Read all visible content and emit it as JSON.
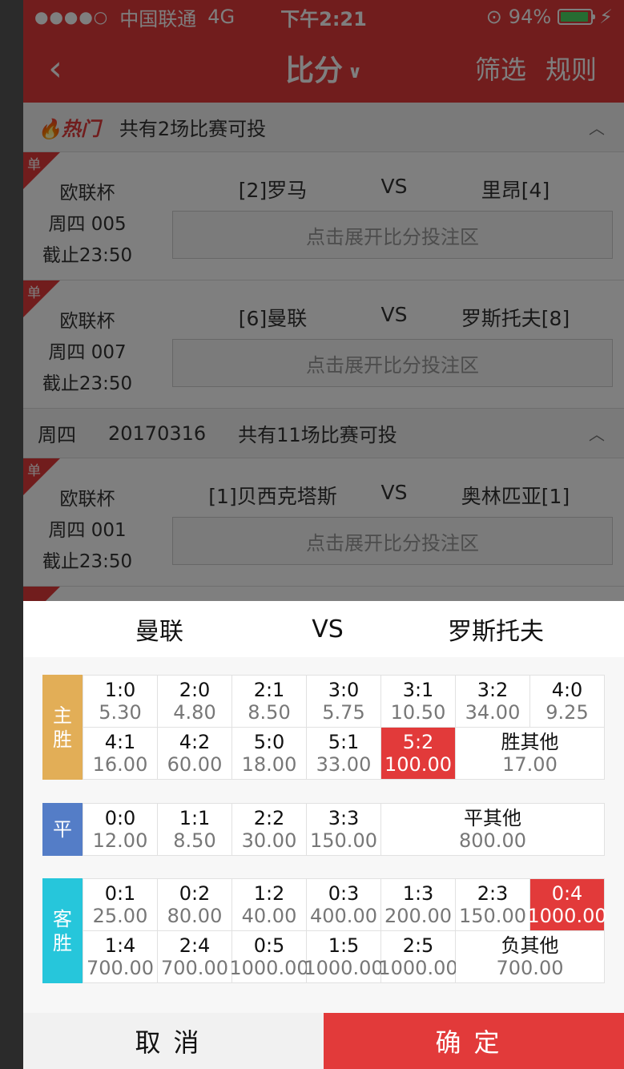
{
  "status_bar": {
    "carrier": "中国联通",
    "network": "4G",
    "time": "下午2:21",
    "battery": "94%",
    "battery_level": 0.94
  },
  "nav": {
    "title": "比分",
    "filter": "筛选",
    "rules": "规则"
  },
  "list": {
    "hot_section": {
      "label": "热门",
      "summary": "共有2场比赛可投"
    },
    "date_section": {
      "weekday": "周四",
      "date": "20170316",
      "summary": "共有11场比赛可投"
    },
    "badge": "单",
    "expand_hint": "点击展开比分投注区",
    "matches": [
      {
        "league": "欧联杯",
        "code": "周四 005",
        "deadline": "截止23:50",
        "home": "[2]罗马",
        "vs": "VS",
        "away": "里昂[4]"
      },
      {
        "league": "欧联杯",
        "code": "周四 007",
        "deadline": "截止23:50",
        "home": "[6]曼联",
        "vs": "VS",
        "away": "罗斯托夫[8]"
      },
      {
        "league": "欧联杯",
        "code": "周四 001",
        "deadline": "截止23:50",
        "home": "[1]贝西克塔斯",
        "vs": "VS",
        "away": "奥林匹亚[1]"
      }
    ]
  },
  "sheet": {
    "home": "曼联",
    "vs": "VS",
    "away": "罗斯托夫",
    "home_win": {
      "label": "主胜",
      "color": "#e2ae57",
      "cells": [
        {
          "score": "1:0",
          "odds": "5.30"
        },
        {
          "score": "2:0",
          "odds": "4.80"
        },
        {
          "score": "2:1",
          "odds": "8.50"
        },
        {
          "score": "3:0",
          "odds": "5.75"
        },
        {
          "score": "3:1",
          "odds": "10.50"
        },
        {
          "score": "3:2",
          "odds": "34.00"
        },
        {
          "score": "4:0",
          "odds": "9.25"
        },
        {
          "score": "4:1",
          "odds": "16.00"
        },
        {
          "score": "4:2",
          "odds": "60.00"
        },
        {
          "score": "5:0",
          "odds": "18.00"
        },
        {
          "score": "5:1",
          "odds": "33.00"
        },
        {
          "score": "5:2",
          "odds": "100.00",
          "selected": true
        },
        {
          "score": "胜其他",
          "odds": "17.00",
          "wide": 2
        }
      ]
    },
    "draw": {
      "label": "平",
      "color": "#547dc7",
      "cells": [
        {
          "score": "0:0",
          "odds": "12.00"
        },
        {
          "score": "1:1",
          "odds": "8.50"
        },
        {
          "score": "2:2",
          "odds": "30.00"
        },
        {
          "score": "3:3",
          "odds": "150.00"
        },
        {
          "score": "平其他",
          "odds": "800.00",
          "wide": 3
        }
      ]
    },
    "away_win": {
      "label": "客胜",
      "color": "#26c6db",
      "cells": [
        {
          "score": "0:1",
          "odds": "25.00"
        },
        {
          "score": "0:2",
          "odds": "80.00"
        },
        {
          "score": "1:2",
          "odds": "40.00"
        },
        {
          "score": "0:3",
          "odds": "400.00"
        },
        {
          "score": "1:3",
          "odds": "200.00"
        },
        {
          "score": "2:3",
          "odds": "150.00"
        },
        {
          "score": "0:4",
          "odds": "1000.00",
          "selected": true
        },
        {
          "score": "1:4",
          "odds": "700.00"
        },
        {
          "score": "2:4",
          "odds": "700.00"
        },
        {
          "score": "0:5",
          "odds": "1000.00"
        },
        {
          "score": "1:5",
          "odds": "1000.00"
        },
        {
          "score": "2:5",
          "odds": "1000.00"
        },
        {
          "score": "负其他",
          "odds": "700.00",
          "wide": 2
        }
      ]
    },
    "cancel": "取消",
    "confirm": "确定"
  },
  "colors": {
    "brand_red": "#e23a3a",
    "border": "#e1e1e1",
    "panel_bg": "#f7f7f7",
    "text": "#111111"
  }
}
